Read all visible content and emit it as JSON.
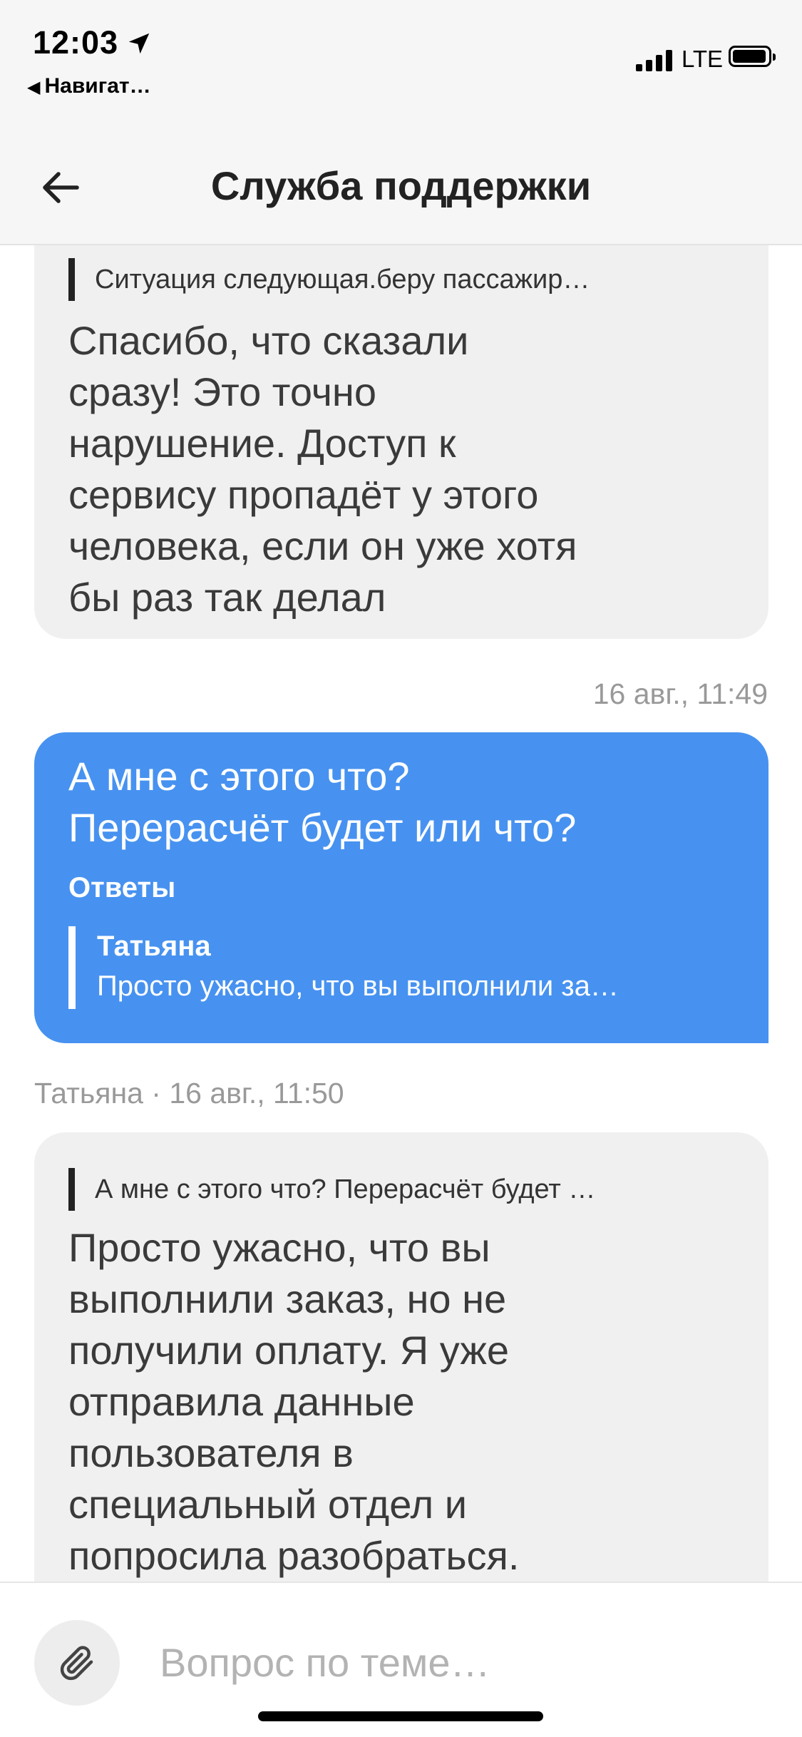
{
  "status_bar": {
    "time": "12:03",
    "back_app_label": "Навигат…",
    "network": "LTE"
  },
  "header": {
    "title": "Служба поддержки"
  },
  "messages": [
    {
      "direction": "incoming",
      "quote": "Ситуация следующая.беру пассажир…",
      "lines": [
        "Спасибо, что сказали",
        "сразу! Это точно",
        "нарушение. Доступ к",
        "сервису пропадёт у этого",
        "человека, если он уже хотя",
        "бы раз так делал"
      ]
    },
    {
      "direction": "outgoing",
      "timestamp": "16 авг., 11:49",
      "lines": [
        "А мне с этого что?",
        "Перерасчёт будет или что?"
      ],
      "answers_label": "Ответы",
      "reply": {
        "author": "Татьяна",
        "text": "Просто ужасно, что вы выполнили за…"
      }
    },
    {
      "direction": "incoming",
      "meta": "Татьяна · 16 авг., 11:50",
      "quote": "А мне с этого что? Перерасчёт будет …",
      "lines": [
        "Просто ужасно, что вы",
        "выполнили заказ, но не",
        "получили оплату. Я уже",
        "отправила данные",
        "пользователя в",
        "специальный отдел и",
        "попросила разобраться."
      ]
    }
  ],
  "composer": {
    "placeholder": "Вопрос по теме…",
    "attach_icon": "paperclip-icon"
  },
  "colors": {
    "outgoing_bubble": "#4792f0",
    "incoming_bubble": "#f0f0f0",
    "header_bg": "#f6f6f6"
  }
}
